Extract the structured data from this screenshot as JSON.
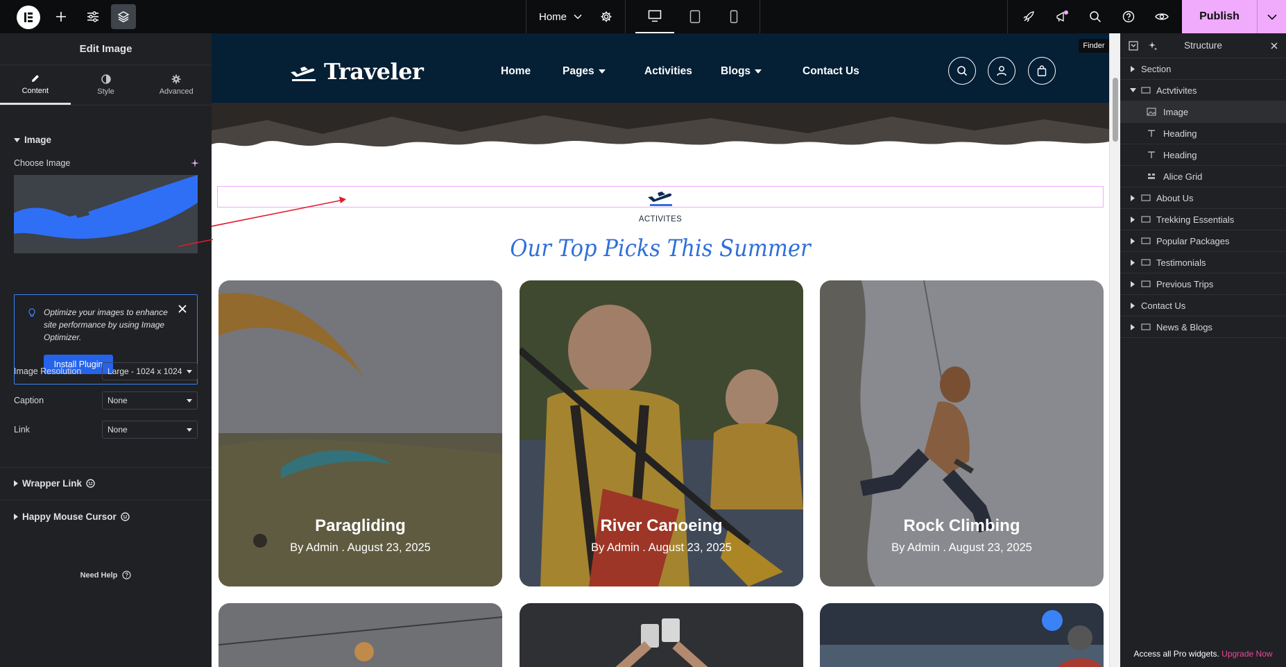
{
  "topbar": {
    "page_name": "Home",
    "publish_label": "Publish",
    "tooltip": "Finder"
  },
  "left_panel": {
    "title": "Edit Image",
    "tabs": [
      {
        "label": "Content",
        "icon": "pencil-icon",
        "active": true
      },
      {
        "label": "Style",
        "icon": "half-circle-icon",
        "active": false
      },
      {
        "label": "Advanced",
        "icon": "gear-icon",
        "active": false
      }
    ],
    "section_image": "Image",
    "choose_image_label": "Choose Image",
    "notice_text": "Optimize your images to enhance site performance by using Image Optimizer.",
    "install_plugin_label": "Install Plugin",
    "image_resolution_label": "Image Resolution",
    "image_resolution_value": "Large - 1024 x 1024",
    "caption_label": "Caption",
    "caption_value": "None",
    "link_label": "Link",
    "link_value": "None",
    "wrapper_link_label": "Wrapper Link",
    "happy_cursor_label": "Happy Mouse Cursor",
    "need_help_label": "Need Help"
  },
  "site": {
    "logo_text": "Traveler",
    "nav": [
      {
        "label": "Home",
        "dropdown": false
      },
      {
        "label": "Pages",
        "dropdown": true
      },
      {
        "label": "Activities",
        "dropdown": false
      },
      {
        "label": "Blogs",
        "dropdown": true
      },
      {
        "label": "Contact Us",
        "dropdown": false
      }
    ],
    "section_label": "ACTIVITES",
    "section_title": "Our Top Picks This Summer",
    "cards": [
      {
        "title": "Paragliding",
        "meta": "By  Admin . August 23, 2025"
      },
      {
        "title": "River Canoeing",
        "meta": "By  Admin . August 23, 2025"
      },
      {
        "title": "Rock Climbing",
        "meta": "By  Admin . August 23, 2025"
      }
    ]
  },
  "structure_panel": {
    "title": "Structure",
    "items": [
      {
        "label": "Section",
        "level": 0,
        "expanded": false,
        "icon": "none"
      },
      {
        "label": "Actvtivites",
        "level": 0,
        "expanded": true,
        "icon": "container-icon"
      },
      {
        "label": "Image",
        "level": 1,
        "icon": "image-icon",
        "selected": true
      },
      {
        "label": "Heading",
        "level": 1,
        "icon": "heading-icon"
      },
      {
        "label": "Heading",
        "level": 1,
        "icon": "heading-icon"
      },
      {
        "label": "Alice Grid",
        "level": 1,
        "icon": "grid-icon"
      },
      {
        "label": "About Us",
        "level": 0,
        "expanded": false,
        "icon": "container-icon"
      },
      {
        "label": "Trekking Essentials",
        "level": 0,
        "expanded": false,
        "icon": "container-icon"
      },
      {
        "label": "Popular Packages",
        "level": 0,
        "expanded": false,
        "icon": "container-icon"
      },
      {
        "label": "Testimonials",
        "level": 0,
        "expanded": false,
        "icon": "container-icon"
      },
      {
        "label": "Previous Trips",
        "level": 0,
        "expanded": false,
        "icon": "container-icon"
      },
      {
        "label": "Contact Us",
        "level": 0,
        "expanded": false,
        "icon": "none"
      },
      {
        "label": "News & Blogs",
        "level": 0,
        "expanded": false,
        "icon": "container-icon"
      }
    ],
    "footer_text": "Access all Pro widgets.",
    "footer_link": "Upgrade Now"
  },
  "colors": {
    "publish": "#f0abfc",
    "header_bg": "#051f35",
    "title_blue": "#2f6fda",
    "panel_bg": "#1f2124",
    "accent_blue": "#2563eb",
    "upgrade_pink": "#ec4899"
  }
}
